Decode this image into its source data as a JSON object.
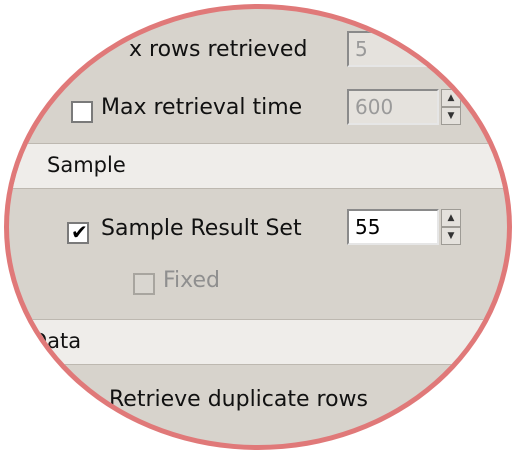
{
  "options": {
    "max_rows": {
      "label": "x rows retrieved",
      "value": "5"
    },
    "max_time": {
      "label": "Max retrieval time",
      "value": "600"
    }
  },
  "sample": {
    "header": "Sample",
    "sample_result_set": {
      "label": "Sample Result Set",
      "value": "55",
      "checked": true
    },
    "fixed": {
      "label": "Fixed",
      "checked": false
    }
  },
  "data": {
    "header": "Data",
    "retrieve_duplicates": {
      "label": "Retrieve duplicate rows"
    }
  },
  "colors": {
    "frame": "#e07979",
    "panel": "#d7d3cc",
    "header_bg": "#efedea"
  },
  "icons": {
    "spin_up": "spin-up-icon",
    "spin_down": "spin-down-icon"
  }
}
